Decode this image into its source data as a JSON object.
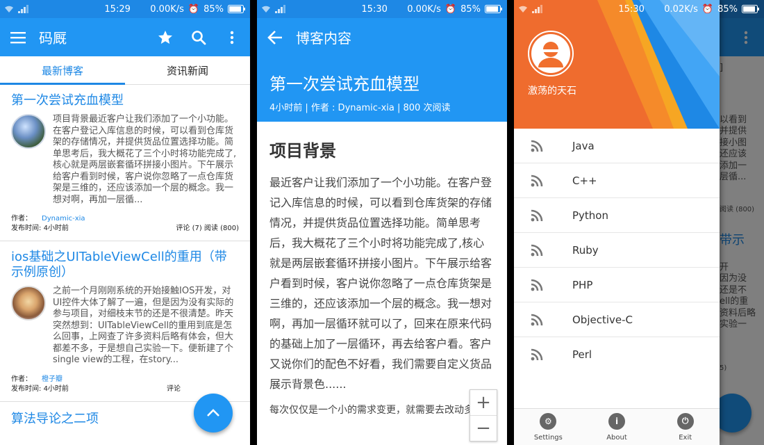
{
  "colors": {
    "primary": "#2196f3",
    "status": "#1e88e5",
    "link": "#1e88e5"
  },
  "status_bars": [
    {
      "time": "15:29",
      "speed": "0.00K/s",
      "battery": "85%"
    },
    {
      "time": "15:30",
      "speed": "0.00K/s",
      "battery": "85%"
    },
    {
      "time": "15:30",
      "speed": "0.02K/s",
      "battery": "85%"
    }
  ],
  "list_screen": {
    "app_title": "码厩",
    "tabs": [
      "最新博客",
      "资讯新闻"
    ],
    "posts": [
      {
        "title": "第一次尝试充血模型",
        "summary": "项目背景最近客户让我们添加了一个小功能。在客户登记入库信息的时候，可以看到仓库货架的存储情况，并提供货品位置选择功能。简单思考后，我大概花了三个小时将功能完成了,核心就是两层嵌套循环拼接小图片。下午展示给客户看到时候，客户说你忽略了一点仓库货架是三维的，还应该添加一个层的概念。我一想对啊，再加一层循...",
        "author_label": "作者：",
        "author": "Dynamic-xia",
        "time_label": "发布时间: ",
        "time": "4小时前",
        "stats": "评论 (7)  阅读 (800)"
      },
      {
        "title": "ios基础之UITableViewCell的重用（带示例原创）",
        "summary": "之前一个月刚刚系统的开始接触IOS开发，对UI控件大体了解了一遍，但是因为没有实际的参与项目，对细枝末节的还是不很清楚。昨天突然想到：UITableViewCell的重用到底是怎么回事，上网查了许多资料后略有体会，但大都差不多，于是想自己实验一下。便新建了个single view的工程，在story...",
        "author_label": "作者：",
        "author": "橙子瓣",
        "time_label": "发布时间: ",
        "time": "4小时前",
        "stats": "评论"
      }
    ],
    "next_title_partial": "算法导论之二项"
  },
  "article_screen": {
    "header_title": "博客内容",
    "title": "第一次尝试充血模型",
    "meta": "4小时前 | 作者 : Dynamic-xia | 800 次阅读",
    "section_heading": "项目背景",
    "paragraph": "最近客户让我们添加了一个小功能。在客户登记入库信息的时候，可以看到仓库货架的存储情况，并提供货品位置选择功能。简单思考后，我大概花了三个小时将功能完成了,核心就是两层嵌套循环拼接小图片。下午展示给客户看到时候，客户说你忽略了一点仓库货架是三维的，还应该添加一个层的概念。我一想对啊，再加一层循环就可以了，回来在原来代码的基础上加了一层循环，再去给客户看。客户又说你们的配色不好看，我们需要自定义货品展示背景色......",
    "paragraph2": "每次仅仅是一个小的需求变更，就需要去改动多",
    "zoom_in": "+",
    "zoom_out": "−"
  },
  "drawer_screen": {
    "username": "激荡的天石",
    "feeds": [
      "Java",
      "C++",
      "Python",
      "Ruby",
      "PHP",
      "Objective-C",
      "Perl"
    ],
    "footer": [
      {
        "label": "Settings",
        "icon": "gear-icon"
      },
      {
        "label": "About",
        "icon": "info-icon"
      },
      {
        "label": "Exit",
        "icon": "power-icon"
      }
    ],
    "bg_fragments": [
      "]",
      "以看到",
      "并提供",
      "接小图",
      "还应该",
      "添加一",
      "层循...",
      "带示",
      "开",
      "因为没",
      "还是不",
      "ell的重",
      "资料后略",
      "实验一",
      "阅读 (800)",
      "5)"
    ]
  }
}
